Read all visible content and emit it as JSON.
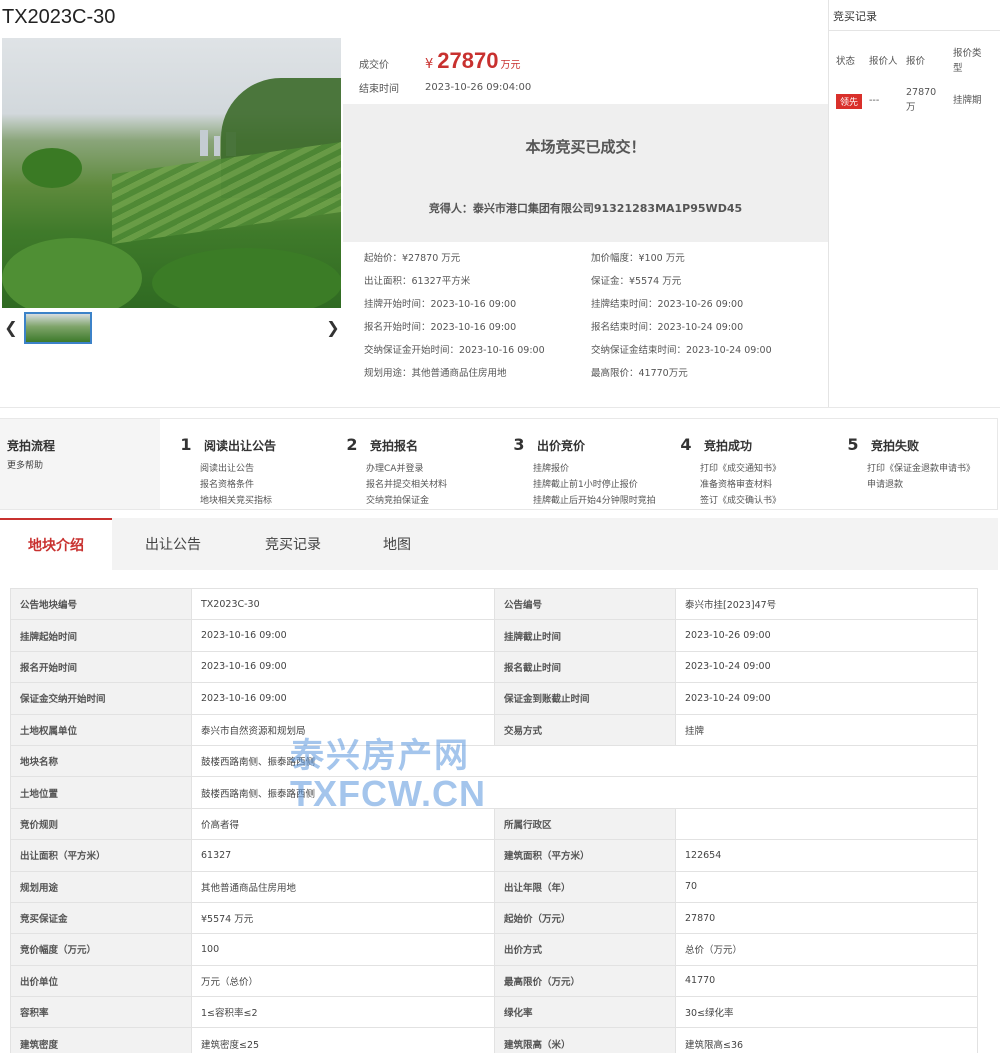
{
  "lot": {
    "title": "TX2023C-30",
    "deal_price_label": "成交价",
    "currency": "¥",
    "deal_price": "27870",
    "deal_price_unit": "万元",
    "end_time_label": "结束时间",
    "end_time": "2023-10-26 09:04:00",
    "deal_message": "本场竞买已成交！",
    "winner": "竞得人：泰兴市港口集团有限公司91321283MA1P95WD45"
  },
  "info": [
    "起始价：¥27870 万元",
    "加价幅度：¥100 万元",
    "出让面积：61327平方米",
    "保证金：¥5574 万元",
    "挂牌开始时间：2023-10-16 09:00",
    "挂牌结束时间：2023-10-26 09:00",
    "报名开始时间：2023-10-16 09:00",
    "报名结束时间：2023-10-24 09:00",
    "交纳保证金开始时间：2023-10-16 09:00",
    "交纳保证金结束时间：2023-10-24 09:00",
    "规划用途：其他普通商品住房用地",
    "最高限价：41770万元"
  ],
  "bids": {
    "title": "竞买记录",
    "headers": [
      "状态",
      "报价人",
      "报价",
      "报价类型"
    ],
    "row": {
      "status": "领先",
      "bidder": "---",
      "price": "27870万",
      "type": "挂牌期"
    }
  },
  "process": {
    "title": "竞拍流程",
    "help": "更多帮助",
    "steps": [
      {
        "num": "1",
        "name": "阅读出让公告",
        "subs": [
          "阅读出让公告",
          "报名资格条件",
          "地块相关竞买指标"
        ]
      },
      {
        "num": "2",
        "name": "竞拍报名",
        "subs": [
          "办理CA并登录",
          "报名并提交相关材料",
          "交纳竞拍保证金"
        ]
      },
      {
        "num": "3",
        "name": "出价竞价",
        "subs": [
          "挂牌报价",
          "挂牌截止前1小时停止报价",
          "挂牌截止后开始4分钟限时竞拍"
        ]
      },
      {
        "num": "4",
        "name": "竞拍成功",
        "subs": [
          "打印《成交通知书》",
          "准备资格审查材料",
          "签订《成交确认书》"
        ]
      },
      {
        "num": "5",
        "name": "竞拍失败",
        "subs": [
          "打印《保证金退款申请书》",
          "申请退款"
        ]
      }
    ]
  },
  "tabs": [
    "地块介绍",
    "出让公告",
    "竞买记录",
    "地图"
  ],
  "table": [
    [
      "公告地块编号",
      "TX2023C-30",
      "公告编号",
      "泰兴市挂[2023]47号"
    ],
    [
      "挂牌起始时间",
      "2023-10-16 09:00",
      "挂牌截止时间",
      "2023-10-26 09:00"
    ],
    [
      "报名开始时间",
      "2023-10-16 09:00",
      "报名截止时间",
      "2023-10-24 09:00"
    ],
    [
      "保证金交纳开始时间",
      "2023-10-16 09:00",
      "保证金到账截止时间",
      "2023-10-24 09:00"
    ],
    [
      "土地权属单位",
      "泰兴市自然资源和规划局",
      "交易方式",
      "挂牌"
    ],
    [
      "地块名称",
      "鼓楼西路南侧、振泰路西侧"
    ],
    [
      "土地位置",
      "鼓楼西路南侧、振泰路西侧"
    ],
    [
      "竞价规则",
      "价高者得",
      "所属行政区",
      ""
    ],
    [
      "出让面积（平方米）",
      "61327",
      "建筑面积（平方米）",
      "122654"
    ],
    [
      "规划用途",
      "其他普通商品住房用地",
      "出让年限（年）",
      "70"
    ],
    [
      "竞买保证金",
      "¥5574 万元",
      "起始价（万元）",
      "27870"
    ],
    [
      "竞价幅度（万元）",
      "100",
      "出价方式",
      "总价（万元）"
    ],
    [
      "出价单位",
      "万元（总价）",
      "最高限价（万元）",
      "41770"
    ],
    [
      "容积率",
      "1≤容积率≤2",
      "绿化率",
      "30≤绿化率"
    ],
    [
      "建筑密度",
      "建筑密度≤25",
      "建筑限高（米）",
      "建筑限高≤36"
    ]
  ],
  "watermark": {
    "line1": "泰兴房产网",
    "line2": "TXFCW.CN"
  },
  "colors": {
    "accent": "#c8312f",
    "lead_badge": "#d9302b",
    "thumb_border": "#3c82c8"
  }
}
